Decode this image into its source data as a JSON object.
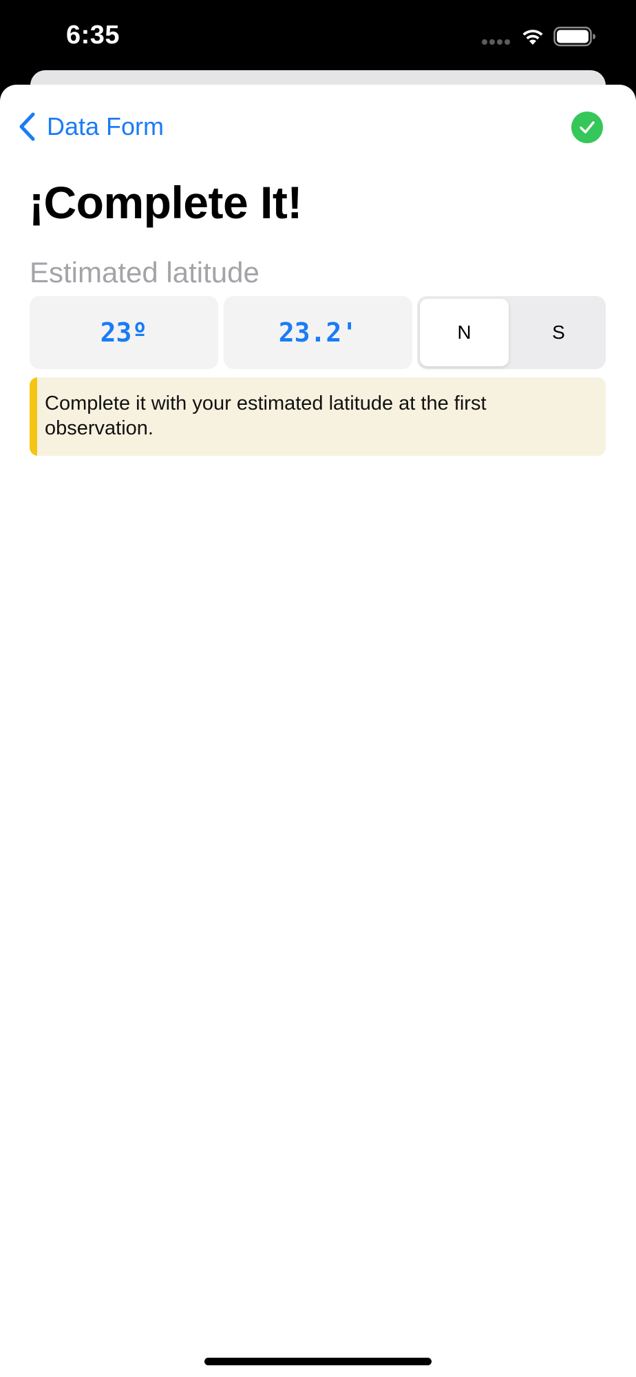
{
  "status_bar": {
    "time": "6:35",
    "icons": [
      "signal-dots-icon",
      "wifi-icon",
      "battery-icon"
    ]
  },
  "nav": {
    "back_label": "Data Form",
    "back_icon": "chevron-left-icon",
    "done_icon": "checkmark-circle-icon"
  },
  "page": {
    "title": "¡Complete It!",
    "field_label": "Estimated latitude"
  },
  "latitude": {
    "degrees": "23º",
    "minutes": "23.2'",
    "hemisphere_options": [
      "N",
      "S"
    ],
    "selected_hemisphere": "N"
  },
  "hint": {
    "text": "Complete it with your estimated latitude at the first observation."
  },
  "colors": {
    "accent_blue": "#1a7cf5",
    "done_green": "#35c759",
    "hint_background": "#f7f1df",
    "hint_accent": "#f5c515",
    "label_gray": "#a3a3a8"
  }
}
